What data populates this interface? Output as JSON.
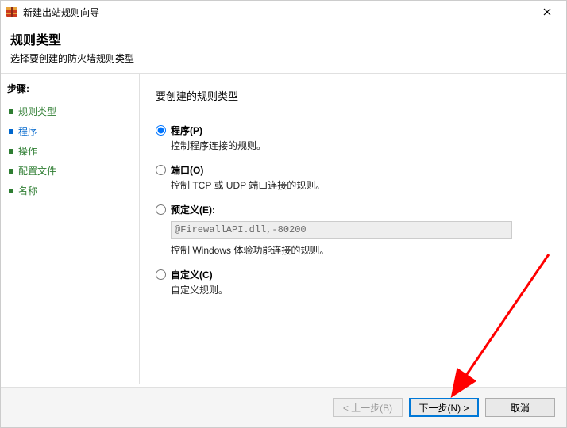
{
  "window": {
    "title": "新建出站规则向导"
  },
  "header": {
    "title": "规则类型",
    "subtitle": "选择要创建的防火墙规则类型"
  },
  "sidebar": {
    "steps_label": "步骤:",
    "items": [
      {
        "label": "规则类型"
      },
      {
        "label": "程序"
      },
      {
        "label": "操作"
      },
      {
        "label": "配置文件"
      },
      {
        "label": "名称"
      }
    ]
  },
  "content": {
    "prompt": "要创建的规则类型",
    "options": {
      "program": {
        "label": "程序(P)",
        "desc": "控制程序连接的规则。"
      },
      "port": {
        "label": "端口(O)",
        "desc": "控制 TCP 或 UDP 端口连接的规则。"
      },
      "predefined": {
        "label": "预定义(E):",
        "select_value": "@FirewallAPI.dll,-80200",
        "desc": "控制 Windows 体验功能连接的规则。"
      },
      "custom": {
        "label": "自定义(C)",
        "desc": "自定义规则。"
      }
    }
  },
  "footer": {
    "back": "< 上一步(B)",
    "next": "下一步(N) >",
    "cancel": "取消"
  }
}
